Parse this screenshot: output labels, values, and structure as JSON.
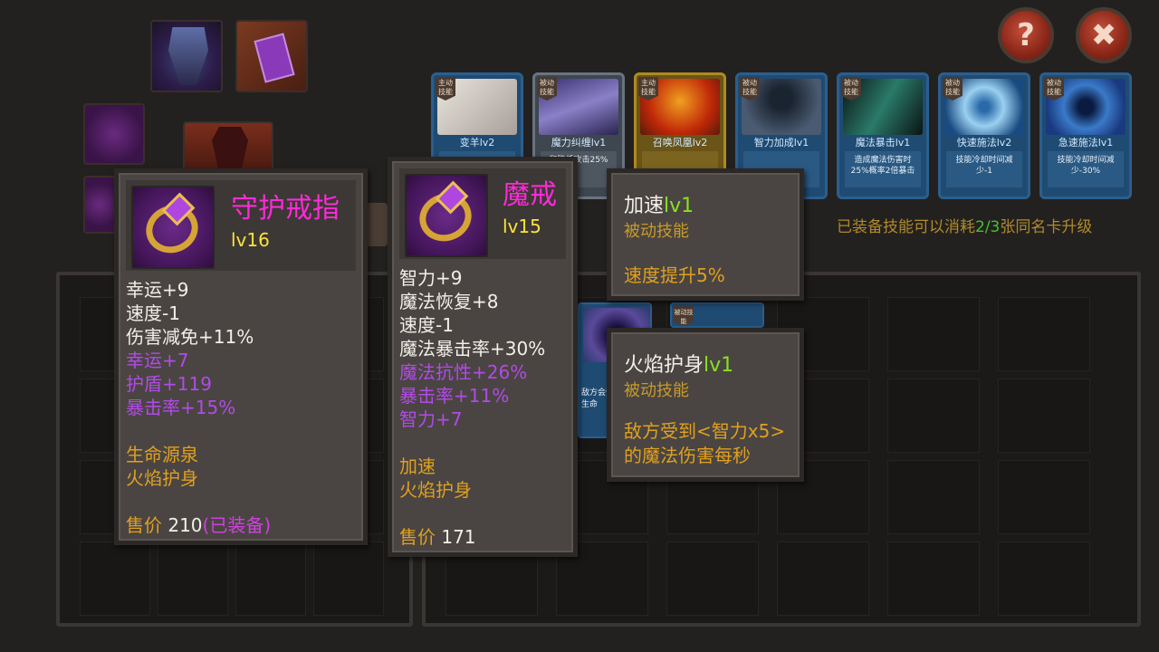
{
  "header": {
    "help_label": "?",
    "close_label": "✖"
  },
  "skill_cards": [
    {
      "tag": "主动技能",
      "name": "变羊lv2",
      "desc": "",
      "style": "blue"
    },
    {
      "tag": "被动技能",
      "name": "魔力纠缠lv1",
      "desc": "和降低攻击25%",
      "style": "grey"
    },
    {
      "tag": "主动技能",
      "name": "召唤凤凰lv2",
      "desc": "",
      "style": "gold"
    },
    {
      "tag": "被动技能",
      "name": "智力加成lv1",
      "desc": "",
      "style": "blue"
    },
    {
      "tag": "被动技能",
      "name": "魔法暴击lv1",
      "desc": "造成魔法伤害时25%概率2倍暴击",
      "style": "blue"
    },
    {
      "tag": "被动技能",
      "name": "快速施法lv2",
      "desc": "技能冷却时间减少-1",
      "style": "blue"
    },
    {
      "tag": "被动技能",
      "name": "急速施法lv1",
      "desc": "技能冷却时间减少-30%",
      "style": "blue"
    }
  ],
  "hint": {
    "prefix": "已装备技能可以消耗",
    "fraction": "2/3",
    "suffix": "张同名卡升级"
  },
  "tooltip_ring1": {
    "name": "守护戒指",
    "level": "lv16",
    "base_stats": [
      "幸运+9",
      "速度-1",
      "伤害减免+11%"
    ],
    "bonus_stats": [
      "幸运+7",
      "护盾+119",
      "暴击率+15%"
    ],
    "skills": [
      "生命源泉",
      "火焰护身"
    ],
    "price_label": "售价",
    "price": "210",
    "equipped": "(已装备)"
  },
  "tooltip_ring2": {
    "name": "魔戒",
    "level": "lv15",
    "base_stats": [
      "智力+9",
      "魔法恢复+8",
      "速度-1",
      "魔法暴击率+30%"
    ],
    "bonus_stats": [
      "魔法抗性+26%",
      "暴击率+11%",
      "智力+7"
    ],
    "skills": [
      "加速",
      "火焰护身"
    ],
    "price_label": "售价",
    "price": "171"
  },
  "tooltip_skill1": {
    "name": "加速",
    "level": "lv1",
    "type": "被动技能",
    "desc": "速度提升5%"
  },
  "tooltip_skill2": {
    "name": "火焰护身",
    "level": "lv1",
    "type": "被动技能",
    "desc": "敌方受到<智力x5>的魔法伤害每秒"
  },
  "background_cards": {
    "partial_tag": "被动技能",
    "partial_desc": "敌方会受生命"
  }
}
